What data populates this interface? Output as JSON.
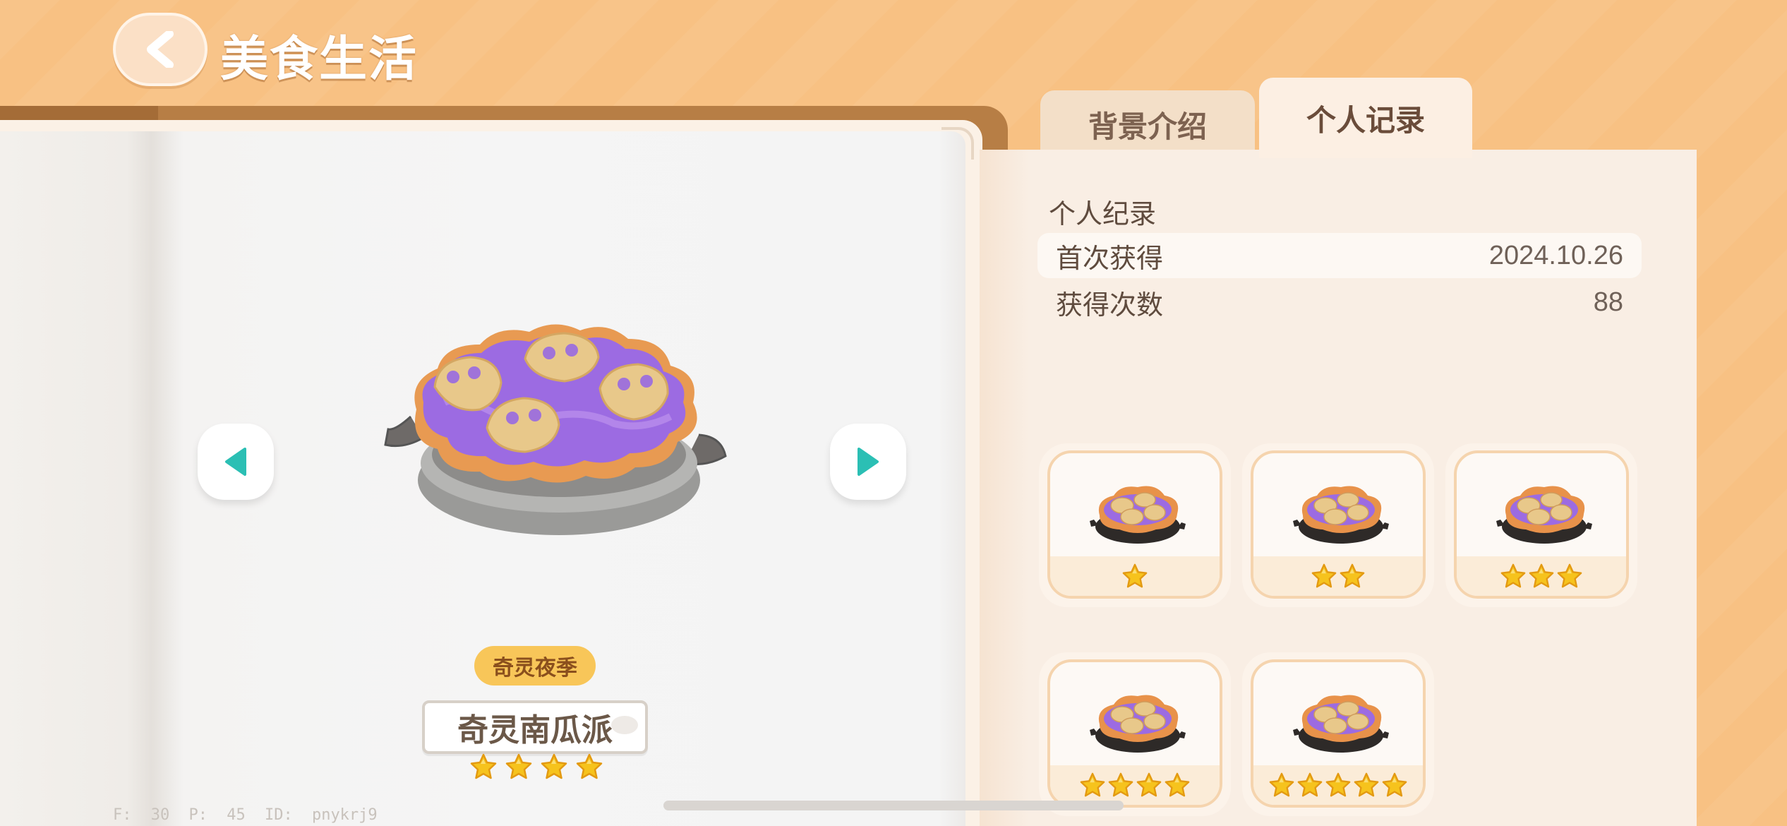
{
  "header": {
    "title": "美食生活"
  },
  "food": {
    "season_badge": "奇灵夜季",
    "name": "奇灵南瓜派",
    "stars": 4
  },
  "tabs": [
    {
      "label": "背景介绍",
      "active": false
    },
    {
      "label": "个人记录",
      "active": true
    }
  ],
  "record": {
    "section_title": "个人纪录",
    "rows": [
      {
        "label": "首次获得",
        "value": "2024.10.26"
      },
      {
        "label": "获得次数",
        "value": "88"
      }
    ]
  },
  "grades": [
    {
      "stars": 1
    },
    {
      "stars": 2
    },
    {
      "stars": 3
    },
    {
      "stars": 4
    },
    {
      "stars": 5
    }
  ],
  "debug": {
    "fps": "F: 30",
    "ping": "P: 45",
    "id": "ID: pnykrj9"
  },
  "icons": {
    "back": "back-arrow-icon",
    "prev": "triangle-left-icon",
    "next": "triangle-right-icon",
    "star": "star-icon",
    "food": "pumpkin-pie-icon"
  },
  "colors": {
    "background": "#f8c183",
    "arrow_teal": "#2bbfb4",
    "star_gold": "#f6c31d",
    "badge": "#f8c659",
    "pie_purple": "#9c6be2"
  }
}
